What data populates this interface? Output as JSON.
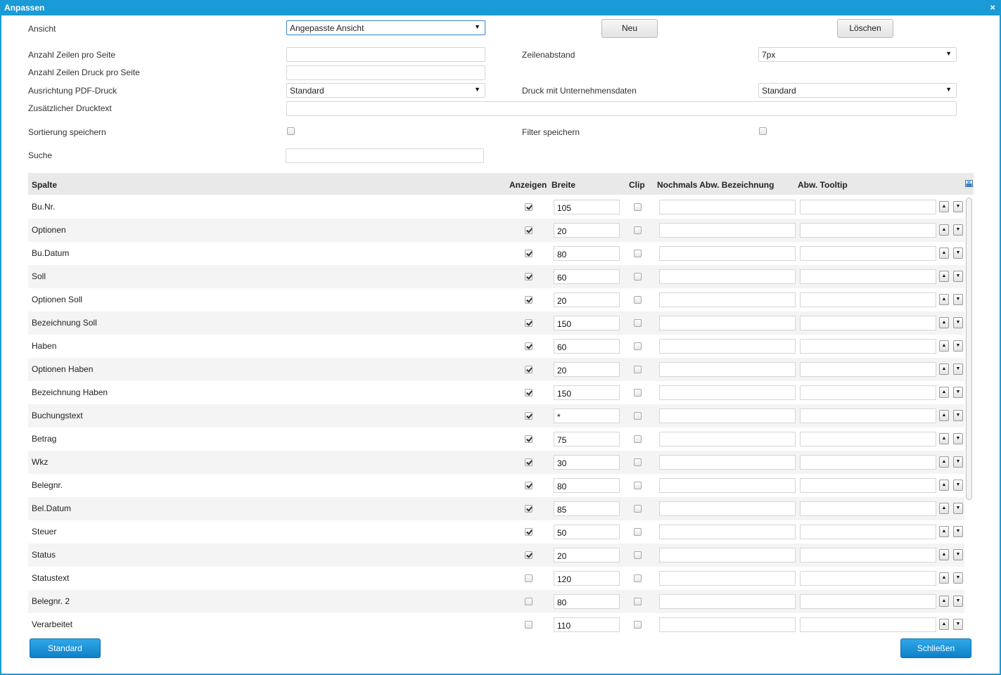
{
  "window": {
    "title": "Anpassen",
    "close_glyph": "×"
  },
  "form": {
    "ansicht_label": "Ansicht",
    "ansicht_value": "Angepasste Ansicht",
    "neu_label": "Neu",
    "loeschen_label": "Löschen",
    "zeilen_label": "Anzahl Zeilen pro Seite",
    "zeilen_value": "",
    "zeilen_druck_label": "Anzahl Zeilen Druck pro Seite",
    "zeilen_druck_value": "",
    "zeilenabstand_label": "Zeilenabstand",
    "zeilenabstand_value": "7px",
    "pdf_label": "Ausrichtung PDF-Druck",
    "pdf_value": "Standard",
    "unternehmen_label": "Druck mit Unternehmensdaten",
    "unternehmen_value": "Standard",
    "drucktext_label": "Zusätzlicher Drucktext",
    "drucktext_value": "",
    "sortierung_label": "Sortierung speichern",
    "sortierung_checked": false,
    "filter_label": "Filter speichern",
    "filter_checked": false,
    "suche_label": "Suche",
    "suche_value": ""
  },
  "grid": {
    "headers": {
      "spalte": "Spalte",
      "anzeigen": "Anzeigen",
      "breite": "Breite",
      "clip": "Clip",
      "bezeichnung": "Nochmals Abw. Bezeichnung",
      "tooltip": "Abw. Tooltip"
    },
    "rows": [
      {
        "name": "Bu.Nr.",
        "show": true,
        "width": "105",
        "clip": false
      },
      {
        "name": "Optionen",
        "show": true,
        "width": "20",
        "clip": false
      },
      {
        "name": "Bu.Datum",
        "show": true,
        "width": "80",
        "clip": false
      },
      {
        "name": "Soll",
        "show": true,
        "width": "60",
        "clip": false
      },
      {
        "name": "Optionen Soll",
        "show": true,
        "width": "20",
        "clip": false
      },
      {
        "name": "Bezeichnung Soll",
        "show": true,
        "width": "150",
        "clip": false
      },
      {
        "name": "Haben",
        "show": true,
        "width": "60",
        "clip": false
      },
      {
        "name": "Optionen Haben",
        "show": true,
        "width": "20",
        "clip": false
      },
      {
        "name": "Bezeichnung Haben",
        "show": true,
        "width": "150",
        "clip": false
      },
      {
        "name": "Buchungstext",
        "show": true,
        "width": "*",
        "clip": false
      },
      {
        "name": "Betrag",
        "show": true,
        "width": "75",
        "clip": false
      },
      {
        "name": "Wkz",
        "show": true,
        "width": "30",
        "clip": false
      },
      {
        "name": "Belegnr.",
        "show": true,
        "width": "80",
        "clip": false
      },
      {
        "name": "Bel.Datum",
        "show": true,
        "width": "85",
        "clip": false
      },
      {
        "name": "Steuer",
        "show": true,
        "width": "50",
        "clip": false
      },
      {
        "name": "Status",
        "show": true,
        "width": "20",
        "clip": false
      },
      {
        "name": "Statustext",
        "show": false,
        "width": "120",
        "clip": false
      },
      {
        "name": "Belegnr. 2",
        "show": false,
        "width": "80",
        "clip": false
      },
      {
        "name": "Verarbeitet",
        "show": false,
        "width": "110",
        "clip": false
      }
    ]
  },
  "footer": {
    "standard_label": "Standard",
    "schliessen_label": "Schließen"
  },
  "colors": {
    "accent": "#1a9ad6",
    "button_blue": "#0e80c8"
  }
}
